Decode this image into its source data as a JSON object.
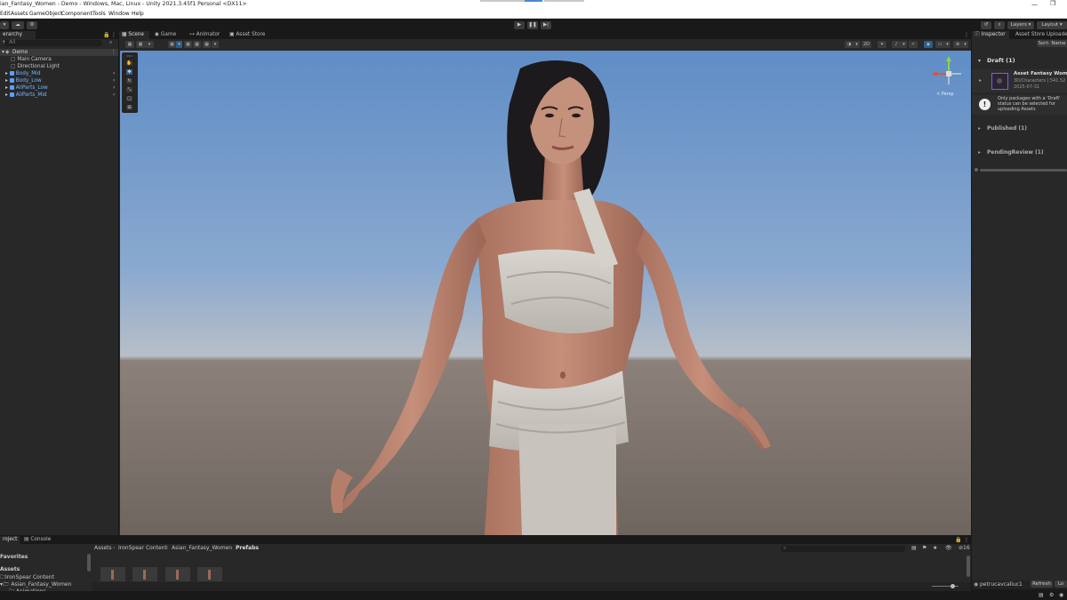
{
  "window": {
    "title": "ian_Fantasy_Women - Demo - Windows, Mac, Linux - Unity 2021.3.45f1 Personal <DX11>"
  },
  "menu": [
    "Edit",
    "Assets",
    "GameObject",
    "Component",
    "Tools",
    "Window",
    "Help"
  ],
  "toolbar": {
    "layers": "Layers",
    "layout": "Layout"
  },
  "hierarchy": {
    "tab": "erarchy",
    "search_placeholder": "All",
    "scene": "Demo",
    "items": [
      {
        "label": "Main Camera",
        "prefab": false
      },
      {
        "label": "Directional Light",
        "prefab": false
      },
      {
        "label": "Body_Mid",
        "prefab": true
      },
      {
        "label": "Body_Low",
        "prefab": true
      },
      {
        "label": "AllParts_Low",
        "prefab": true
      },
      {
        "label": "AllParts_Mid",
        "prefab": true
      }
    ]
  },
  "scene_tabs": [
    "Scene",
    "Game",
    "Animator",
    "Asset Store"
  ],
  "scene_toolbar": {
    "mode_2d": "2D"
  },
  "gizmo": {
    "label": "< Persp"
  },
  "inspector": {
    "tabs": [
      "Inspector",
      "Asset Store Uploader"
    ],
    "sort": "Sort: Name",
    "draft_header": "Draft (1)",
    "package": {
      "name": "Asset Fantasy Women",
      "category": "3D/Characters | 541.52",
      "date": "2025-07-31"
    },
    "notice": "Only packages with a 'Draft' status can be selected for uploading Assets",
    "published": "Published (1)",
    "pending": "PendingReview (1)",
    "user": "petrucavcaliuc1",
    "refresh": "Refresh",
    "logout": "Lo"
  },
  "bottom": {
    "tabs": [
      "roject",
      "Console"
    ],
    "favorites": "Favorites",
    "assets_header": "Assets",
    "tree": [
      "IronSpear Content",
      "Asian_Fantasy_Women",
      "Animations"
    ],
    "breadcrumb": [
      "Assets",
      "IronSpear Content",
      "Asian_Fantasy_Women",
      "Prefabs"
    ],
    "count": "16"
  },
  "colors": {
    "accent": "#2c5d87",
    "prefab_text": "#7cb3ff",
    "sky_top": "#5f8dc6",
    "ground": "#746a63"
  }
}
